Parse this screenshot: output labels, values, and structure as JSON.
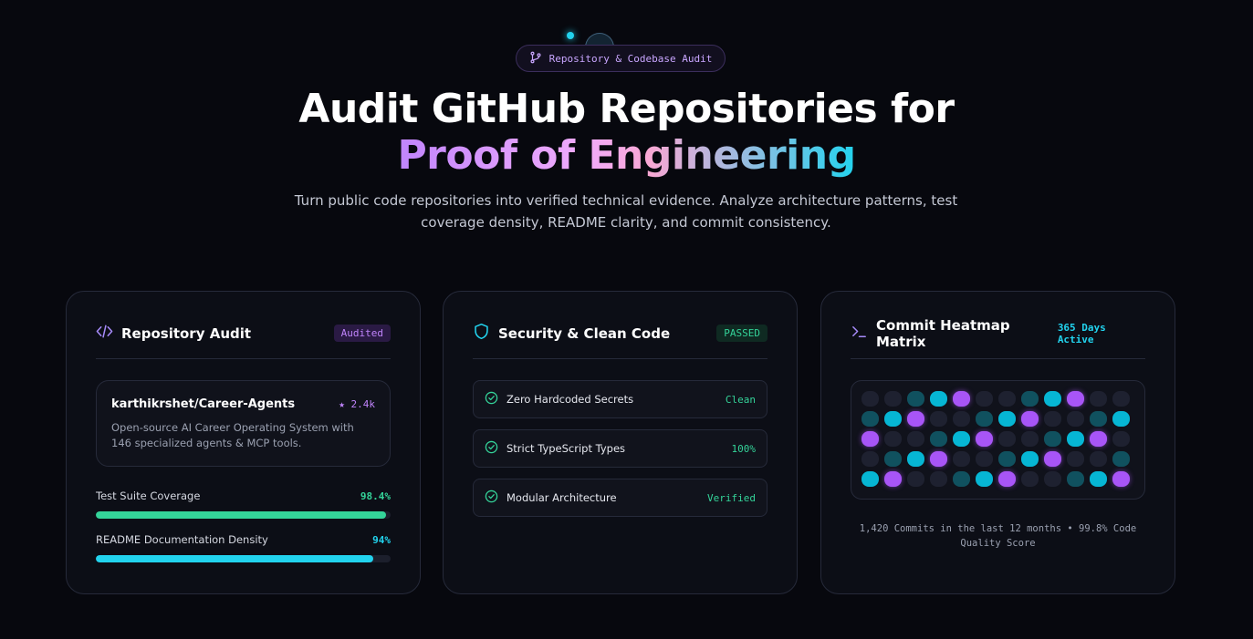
{
  "hero": {
    "pill_label": "Repository & Codebase Audit",
    "title_line1": "Audit GitHub Repositories for",
    "title_line2": "Proof of Engineering",
    "subtitle": "Turn public code repositories into verified technical evidence. Analyze architecture patterns, test coverage density, README clarity, and commit consistency."
  },
  "cards": {
    "repo_audit": {
      "title": "Repository Audit",
      "badge": "Audited",
      "repo_name": "karthikrshet/Career-Agents",
      "stars": "★ 2.4k",
      "description": "Open-source AI Career Operating System with 146 specialized agents & MCP tools.",
      "metrics": [
        {
          "label": "Test Suite Coverage",
          "value": "98.4%",
          "fraction": 0.984,
          "color": "#34d399"
        },
        {
          "label": "README Documentation Density",
          "value": "94%",
          "fraction": 0.94,
          "color": "#22d3ee"
        }
      ]
    },
    "security": {
      "title": "Security & Clean Code",
      "badge": "PASSED",
      "checks": [
        {
          "label": "Zero Hardcoded Secrets",
          "value": "Clean"
        },
        {
          "label": "Strict TypeScript Types",
          "value": "100%"
        },
        {
          "label": "Modular Architecture",
          "value": "Verified"
        }
      ]
    },
    "heatmap": {
      "title": "Commit Heatmap Matrix",
      "badge": "365 Days Active",
      "levels": [
        [
          0,
          0,
          1,
          2,
          3,
          0,
          0,
          1,
          2,
          3,
          0,
          0
        ],
        [
          1,
          2,
          3,
          0,
          0,
          1,
          2,
          3,
          0,
          0,
          1,
          2
        ],
        [
          3,
          0,
          0,
          1,
          2,
          3,
          0,
          0,
          1,
          2,
          3,
          0
        ],
        [
          0,
          1,
          2,
          3,
          0,
          0,
          1,
          2,
          3,
          0,
          0,
          1
        ],
        [
          2,
          3,
          0,
          0,
          1,
          2,
          3,
          0,
          0,
          1,
          2,
          3
        ]
      ],
      "caption": "1,420 Commits in the last 12 months • 99.8% Code Quality Score"
    }
  },
  "colors": {
    "accent_purple": "#c084fc",
    "accent_cyan": "#22d3ee",
    "success_green": "#34d399"
  },
  "icons": {
    "pill": "git-branch-icon",
    "repo_audit": "code-icon",
    "security": "shield-icon",
    "heatmap": "terminal-icon",
    "check": "check-circle-icon"
  }
}
